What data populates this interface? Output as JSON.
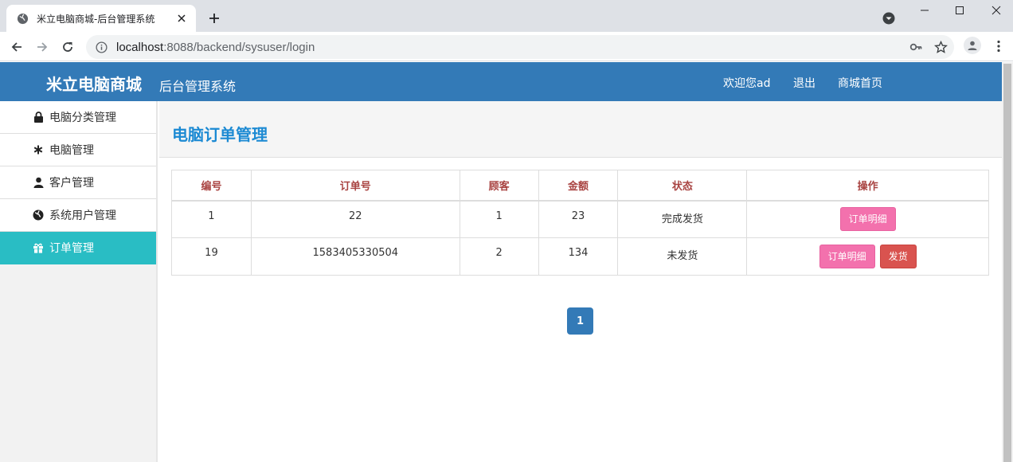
{
  "browser": {
    "tab_title": "米立电脑商城-后台管理系统",
    "url_host": "localhost",
    "url_rest": ":8088/backend/sysuser/login"
  },
  "header": {
    "brand": "米立电脑商城",
    "subtitle": "后台管理系统",
    "nav": [
      "欢迎您ad",
      "退出",
      "商城首页"
    ]
  },
  "sidebar": {
    "items": [
      {
        "label": "电脑分类管理",
        "icon": "lock-icon"
      },
      {
        "label": "电脑管理",
        "icon": "asterisk-icon"
      },
      {
        "label": "客户管理",
        "icon": "user-icon"
      },
      {
        "label": "系统用户管理",
        "icon": "globe-icon"
      },
      {
        "label": "订单管理",
        "icon": "gift-icon",
        "active": true
      }
    ]
  },
  "main": {
    "title": "电脑订单管理",
    "table": {
      "headers": [
        "编号",
        "订单号",
        "顾客",
        "金额",
        "状态",
        "操作"
      ],
      "rows": [
        {
          "id": "1",
          "order_no": "22",
          "customer": "1",
          "amount": "23",
          "status": "完成发货",
          "actions": [
            "订单明细"
          ]
        },
        {
          "id": "19",
          "order_no": "1583405330504",
          "customer": "2",
          "amount": "134",
          "status": "未发货",
          "actions": [
            "订单明细",
            "发货"
          ]
        }
      ]
    },
    "pagination": {
      "current": "1"
    }
  },
  "colors": {
    "header_bg": "#337ab7",
    "sidebar_active": "#29bdc4",
    "title_blue": "#1c8ad3",
    "th_text": "#a94442",
    "btn_detail": "#f371ad",
    "btn_ship": "#d9534f"
  }
}
